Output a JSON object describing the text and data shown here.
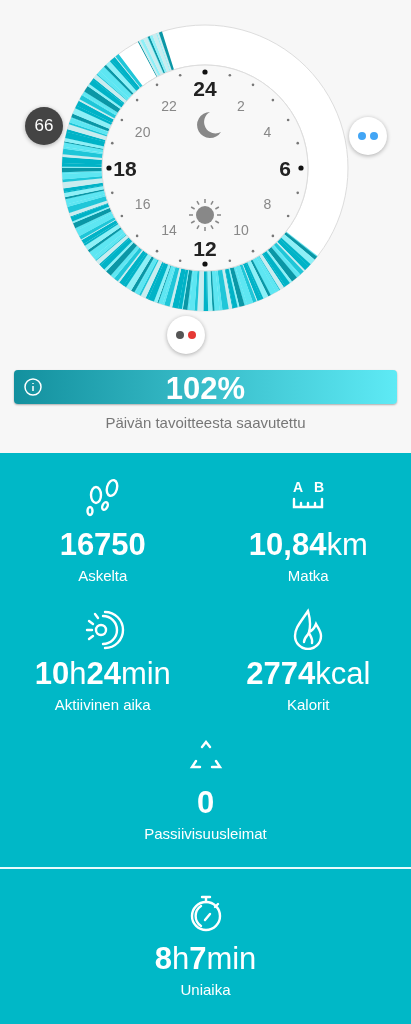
{
  "clock": {
    "hours": [
      {
        "label": "24",
        "kind": "major"
      },
      {
        "label": "2",
        "kind": "minor"
      },
      {
        "label": "4",
        "kind": "minor"
      },
      {
        "label": "6",
        "kind": "major"
      },
      {
        "label": "8",
        "kind": "minor"
      },
      {
        "label": "10",
        "kind": "minor"
      },
      {
        "label": "12",
        "kind": "major"
      },
      {
        "label": "14",
        "kind": "minor"
      },
      {
        "label": "16",
        "kind": "minor"
      },
      {
        "label": "18",
        "kind": "major"
      },
      {
        "label": "20",
        "kind": "minor"
      },
      {
        "label": "22",
        "kind": "minor"
      }
    ],
    "marker_count": "66",
    "right_marker_dots": [
      {
        "color": "#42a5f5"
      },
      {
        "color": "#42a5f5"
      }
    ],
    "bottom_marker_dots": [
      {
        "color": "#555555"
      },
      {
        "color": "#e53935"
      }
    ]
  },
  "goal": {
    "level": 1,
    "percent": "102%",
    "caption": "Päivän tavoitteesta saavutettu"
  },
  "stats": [
    {
      "kind": "steps",
      "value": [
        {
          "text": "16750",
          "kind": "number"
        }
      ],
      "label": "Askelta"
    },
    {
      "kind": "distance",
      "icon_letters": [
        "A",
        "B"
      ],
      "value": [
        {
          "text": "10,84",
          "kind": "number"
        },
        {
          "text": "km",
          "kind": "unit"
        }
      ],
      "label": "Matka"
    },
    {
      "kind": "active",
      "value": [
        {
          "text": "10",
          "kind": "number"
        },
        {
          "text": "h",
          "kind": "unit"
        },
        {
          "text": "24",
          "kind": "number"
        },
        {
          "text": "min",
          "kind": "unit"
        }
      ],
      "label": "Aktiivinen aika"
    },
    {
      "kind": "calories",
      "value": [
        {
          "text": "2774",
          "kind": "number"
        },
        {
          "text": "kcal",
          "kind": "unit"
        }
      ],
      "label": "Kalorit"
    },
    {
      "kind": "inactivity",
      "value": [
        {
          "text": "0",
          "kind": "number"
        }
      ],
      "label": "Passiivisuusleimat"
    }
  ],
  "sleep": {
    "value": [
      {
        "text": "8",
        "kind": "number"
      },
      {
        "text": "h",
        "kind": "unit"
      },
      {
        "text": "7",
        "kind": "number"
      },
      {
        "text": "min",
        "kind": "unit"
      }
    ],
    "label": "Uniaika"
  }
}
